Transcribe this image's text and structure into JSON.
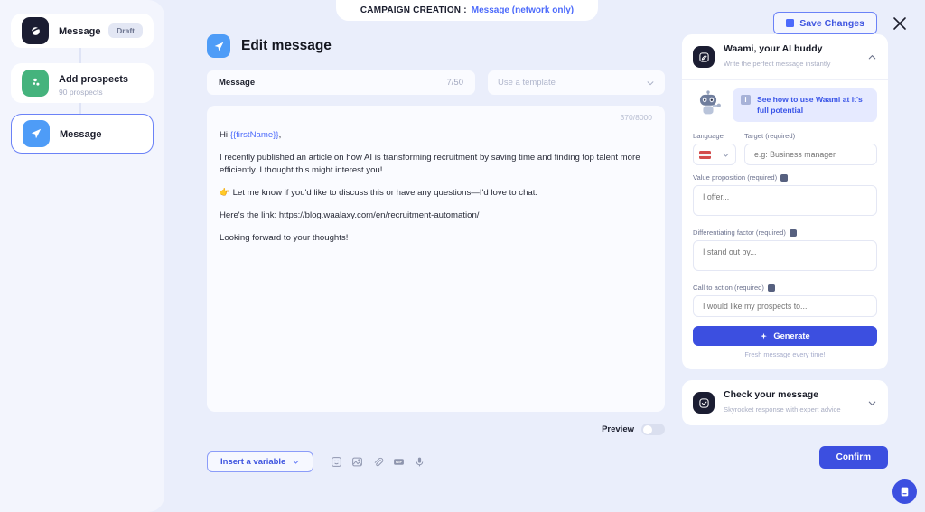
{
  "topbar": {
    "label": "CAMPAIGN CREATION :",
    "value": "Message (network only)",
    "save_label": "Save Changes"
  },
  "sidebar": {
    "nodes": [
      {
        "title": "Message",
        "sub": "",
        "badge": "Draft",
        "icon": "planet-icon",
        "color": "#1b1d32",
        "selected": false
      },
      {
        "title": "Add prospects",
        "sub": "90 prospects",
        "badge": "",
        "icon": "people-icon",
        "color": "#45b37d",
        "selected": false
      },
      {
        "title": "Message",
        "sub": "",
        "badge": "",
        "icon": "send-icon",
        "color": "#4e9cf7",
        "selected": true
      }
    ]
  },
  "editor": {
    "heading": "Edit message",
    "name_label": "Message",
    "name_counter": "7/50",
    "template_placeholder": "Use a template",
    "body_counter": "370/8000",
    "body": {
      "greeting_prefix": "Hi ",
      "greeting_variable": "{{firstName}}",
      "greeting_suffix": ",",
      "p1": "I recently published an article on how AI is transforming recruitment by saving time and finding top talent more efficiently. I thought this might interest you!",
      "p2": "👉 Let me know if you'd like to discuss this or have any questions—I'd love to chat.",
      "p3": "Here's the link: https://blog.waalaxy.com/en/recruitment-automation/",
      "p4": "Looking forward to your thoughts!"
    },
    "preview_label": "Preview",
    "insert_variable_label": "Insert a variable",
    "toolbar_icons": [
      "emoji-icon",
      "image-icon",
      "attachment-icon",
      "gif-icon",
      "microphone-icon"
    ],
    "confirm_label": "Confirm"
  },
  "waami": {
    "title": "Waami, your AI buddy",
    "subtitle": "Write the perfect message instantly",
    "hint": "See how to use Waami at it's full potential",
    "language_label": "Language",
    "target_label": "Target (required)",
    "target_placeholder": "e.g: Business manager",
    "value_prop_label": "Value proposition (required)",
    "value_prop_placeholder": "I offer...",
    "diff_label": "Differentiating factor (required)",
    "diff_placeholder": "I stand out by...",
    "cta_label": "Call to action (required)",
    "cta_placeholder": "I would like my prospects to...",
    "generate_label": "Generate",
    "fresh_note": "Fresh message every time!"
  },
  "check": {
    "title": "Check your message",
    "subtitle": "Skyrocket response with expert advice"
  },
  "colors": {
    "accent": "#3c4fe0",
    "link": "#4d6bfb",
    "background": "#eaeefb",
    "panel": "#f3f5fd"
  }
}
